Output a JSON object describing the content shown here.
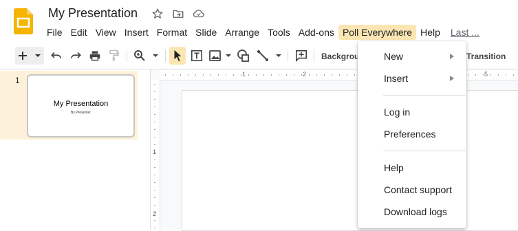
{
  "header": {
    "doc_title": "My Presentation",
    "icons": [
      "star-icon",
      "move-to-folder-icon",
      "cloud-saved-icon"
    ]
  },
  "menubar": {
    "items": [
      "File",
      "Edit",
      "View",
      "Insert",
      "Format",
      "Slide",
      "Arrange",
      "Tools",
      "Add-ons",
      "Poll Everywhere",
      "Help"
    ],
    "active_item": "Poll Everywhere",
    "last_edit": "Last ..."
  },
  "toolbar": {
    "background_label": "Backgroun",
    "transition_label": "Transition"
  },
  "filmstrip": {
    "slides": [
      {
        "number": "1",
        "title": "My Presentation",
        "subtitle": "By Presenter"
      }
    ]
  },
  "ruler": {
    "top_numbers": [
      "1",
      "2",
      "5"
    ],
    "left_numbers": [
      "1",
      "2"
    ]
  },
  "dropdown": {
    "items": [
      {
        "label": "New",
        "submenu": true
      },
      {
        "label": "Insert",
        "submenu": true
      },
      {
        "label": "Log in",
        "submenu": false
      },
      {
        "label": "Preferences",
        "submenu": false
      },
      {
        "label": "Help",
        "submenu": false
      },
      {
        "label": "Contact support",
        "submenu": false
      },
      {
        "label": "Download logs",
        "submenu": false
      }
    ]
  },
  "colors": {
    "brand_yellow": "#f4b400",
    "active_menu_bg": "#fbe6b3",
    "selected_slide_bg": "#fdf2d9"
  }
}
